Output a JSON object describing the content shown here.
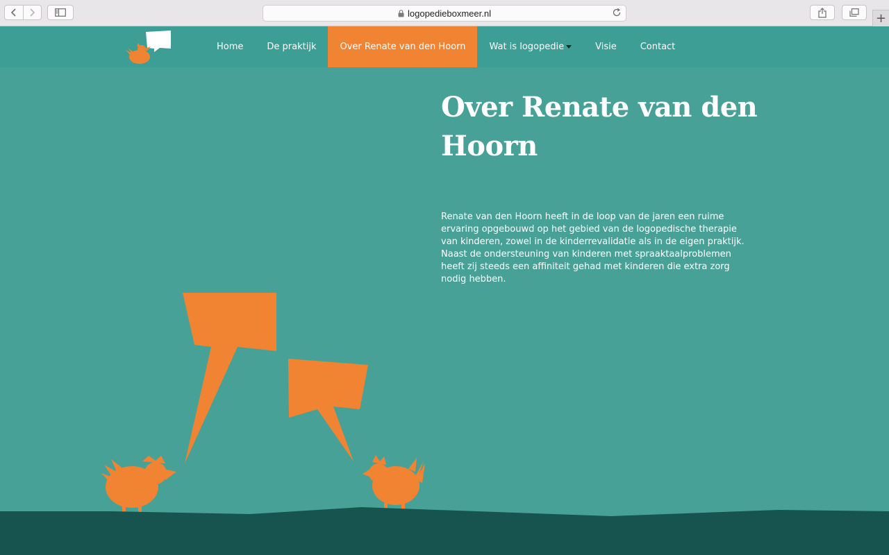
{
  "browser": {
    "url": "logopedieboxmeer.nl",
    "icons": [
      "back-icon",
      "forward-icon",
      "sidebar-icon",
      "lock-icon",
      "reload-icon",
      "share-icon",
      "tabs-icon",
      "plus-icon"
    ]
  },
  "nav": {
    "items": [
      {
        "label": "Home"
      },
      {
        "label": "De praktijk"
      },
      {
        "label": "Over Renate van den Hoorn",
        "active": true
      },
      {
        "label": "Wat is logopedie",
        "dropdown": true
      },
      {
        "label": "Visie"
      },
      {
        "label": "Contact"
      }
    ]
  },
  "page": {
    "title": "Over Renate van den Hoorn",
    "intro": "Renate van den Hoorn heeft in de loop van de jaren een ruime ervaring opgebouwd op het gebied van de logopedische therapie van kinderen, zowel in de kinderrevalidatie als in de eigen praktijk. Naast de ondersteuning van kinderen met spraaktaalproblemen heeft zij steeds een affiniteit gehad met kinderen die extra zorg nodig hebben."
  },
  "colors": {
    "background": "#48a196",
    "header": "#3c9e94",
    "accent": "#f08433",
    "ground": "#17544f",
    "text": "#ffffff"
  }
}
